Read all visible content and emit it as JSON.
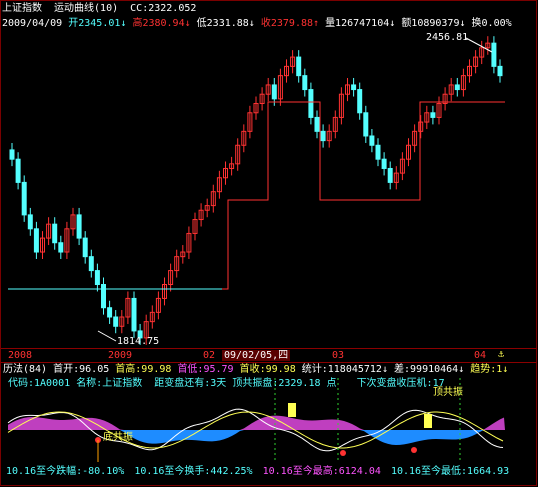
{
  "title_bar": {
    "index_name": "上证指数",
    "indicator": "运动曲线(10)",
    "cc": "CC:2322.052"
  },
  "quote_bar": {
    "date": "2009/04/09",
    "open": "开2345.01↓",
    "high": "高2380.94↓",
    "low": "低2331.88↓",
    "close": "收2379.88↑",
    "volume": "量126747104↓",
    "amount": "额10890379↓",
    "turnover": "换0.00%"
  },
  "chart_labels": {
    "max": "2456.81",
    "min": "1814.75"
  },
  "time_axis": {
    "t2008": "2008",
    "t2009": "2009",
    "t02": "02",
    "highlight": "09/02/05,四",
    "t03": "03",
    "t04": "04"
  },
  "status1": {
    "history": "历法(84)",
    "first_open": "首开:96.05",
    "first_high": "首高:99.98",
    "first_low": "首低:95.79",
    "first_close": "首收:99.98",
    "stat": "统计:118045712↓",
    "diff": "差:99910464↓",
    "trend": "趋势:1↓"
  },
  "status2": {
    "code": "代码:1A0001",
    "name": "名称:上证指数",
    "dist": "距变盘还有:3",
    "day": "天",
    "top_label": "顶共振盘:2329.18",
    "dot": "点",
    "next": "下次变盘收压机:17"
  },
  "osc_labels": {
    "top": "顶共振",
    "bottom": "底共振"
  },
  "bottom_bar": {
    "amp": "10.16至今跌幅:-80.10%",
    "turn": "10.16至今换手:442.25%",
    "high": "10.16至今最高:6124.04",
    "low": "10.16至今最低:1664.93"
  },
  "colors": {
    "up": "#ff3232",
    "down": "#54ffff",
    "line": "#ff3232",
    "cyan": "#54ffff",
    "yellow": "#ffff54",
    "magenta": "#ff54ff",
    "orange": "#ffa000"
  }
}
